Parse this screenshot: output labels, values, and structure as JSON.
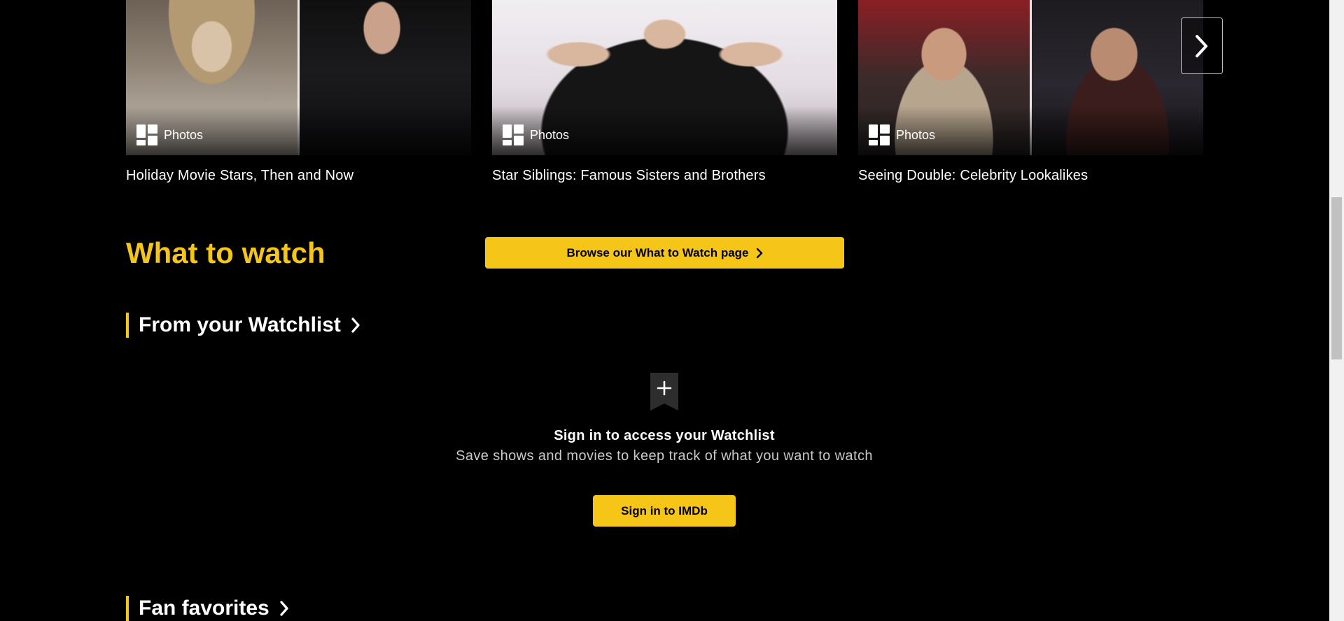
{
  "gallery": {
    "cards": [
      {
        "badge_label": "Photos",
        "caption": "Holiday Movie Stars, Then and Now"
      },
      {
        "badge_label": "Photos",
        "caption": "Star Siblings: Famous Sisters and Brothers"
      },
      {
        "badge_label": "Photos",
        "caption": "Seeing Double: Celebrity Lookalikes"
      }
    ]
  },
  "what_to_watch": {
    "title": "What to watch",
    "browse_label": "Browse our What to Watch page"
  },
  "watchlist": {
    "heading": "From your Watchlist",
    "signin_title": "Sign in to access your Watchlist",
    "signin_subtitle": "Save shows and movies to keep track of what you want to watch",
    "signin_button": "Sign in to IMDb"
  },
  "fan_favorites": {
    "heading": "Fan favorites"
  },
  "colors": {
    "accent": "#f5c518",
    "background": "#000000",
    "muted_text": "#c9c9c9"
  },
  "icons": {
    "badge": "photo-grid-icon",
    "next": "chevron-right-icon",
    "watchlist_add": "bookmark-plus-icon"
  }
}
